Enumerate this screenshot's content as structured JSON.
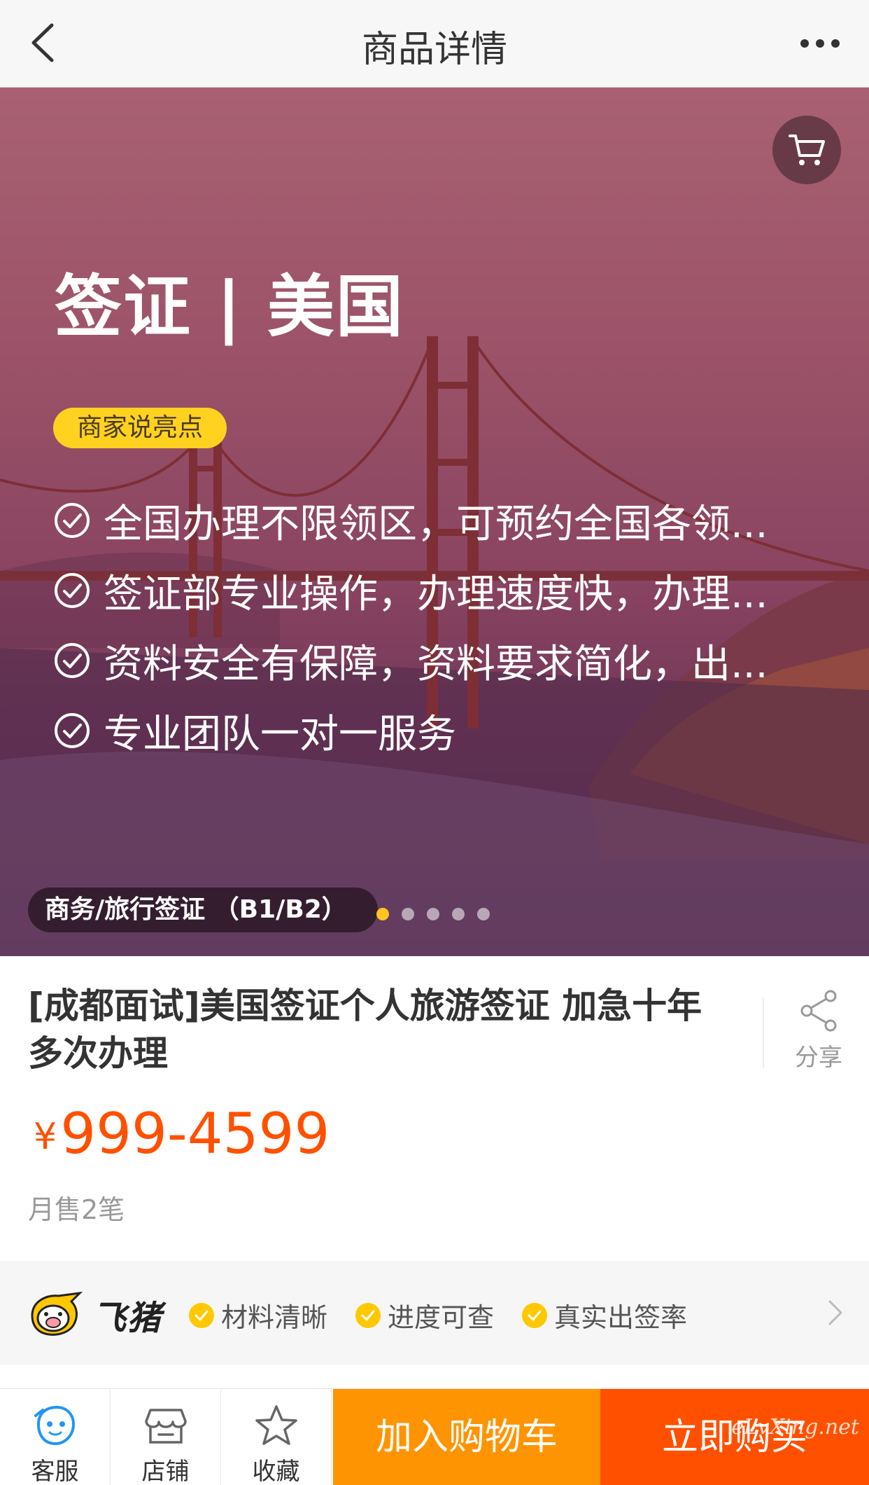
{
  "nav": {
    "title": "商品详情",
    "back_icon": "chevron-left-icon",
    "more_icon": "more-dots-icon"
  },
  "hero": {
    "title": "签证 | 美国",
    "badge": "商家说亮点",
    "highlights": [
      "全国办理不限领区，可预约全国各领...",
      "签证部专业操作，办理速度快，办理...",
      "资料安全有保障，资料要求简化，出...",
      "专业团队一对一服务"
    ],
    "type_label": "商务/旅行签证 （B1/B2）",
    "carousel": {
      "count": 5,
      "active": 0
    },
    "colors": {
      "overlay": "#9c5369",
      "badge": "#ffd21f",
      "active_dot": "#ffc41d"
    }
  },
  "product": {
    "title": "[成都面试]美国签证个人旅游签证 加急十年多次办理",
    "currency": "¥",
    "price": "999-4599",
    "sales": "月售2笔",
    "share_label": "分享",
    "price_color": "#ff5000"
  },
  "guarantee": {
    "brand": "飞猪",
    "items": [
      "材料清晰",
      "进度可查",
      "真实出签率"
    ]
  },
  "tabbar": {
    "service_label": "客服",
    "shop_label": "店铺",
    "favorite_label": "收藏",
    "add_cart_label": "加入购物车",
    "buy_label": "立即购买",
    "add_cart_color": "#ff9402",
    "buy_color": "#ff5000"
  },
  "watermark": "eLvXing.net"
}
